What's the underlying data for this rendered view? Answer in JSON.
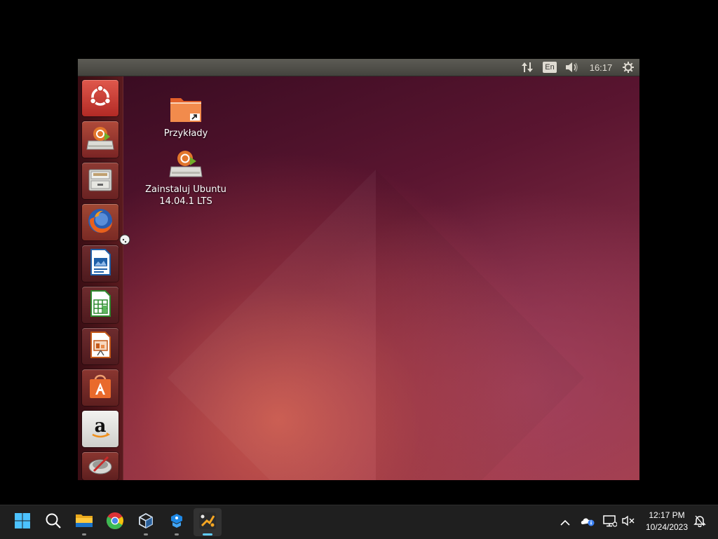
{
  "vm": {
    "panel": {
      "language_indicator": "En",
      "clock": "16:17",
      "icons": [
        "network-transfer-icon",
        "volume-icon",
        "system-gear-icon"
      ]
    },
    "launcher": {
      "items": [
        {
          "name": "dash-home",
          "icon": "ubuntu-logo-icon"
        },
        {
          "name": "install-ubuntu",
          "icon": "installer-icon"
        },
        {
          "name": "files",
          "icon": "file-cabinet-icon"
        },
        {
          "name": "firefox",
          "icon": "firefox-icon"
        },
        {
          "name": "libreoffice-writer",
          "icon": "writer-icon"
        },
        {
          "name": "libreoffice-calc",
          "icon": "calc-icon"
        },
        {
          "name": "libreoffice-impress",
          "icon": "impress-icon"
        },
        {
          "name": "ubuntu-software-center",
          "icon": "shopping-bag-icon"
        },
        {
          "name": "amazon",
          "icon": "amazon-icon"
        },
        {
          "name": "system-settings",
          "icon": "settings-icon"
        }
      ]
    },
    "desktop": {
      "icons": [
        {
          "label": "Przykłady",
          "icon": "folder-link-icon"
        },
        {
          "label": "Zainstaluj Ubuntu 14.04.1 LTS",
          "icon": "installer-icon"
        }
      ]
    },
    "colors": {
      "accent": "#dd4814",
      "panel": "#4a4944",
      "launcher": "#4c1419"
    }
  },
  "taskbar": {
    "apps": [
      {
        "name": "start",
        "icon": "windows-start-icon"
      },
      {
        "name": "search",
        "icon": "search-icon"
      },
      {
        "name": "file-explorer",
        "icon": "folder-icon"
      },
      {
        "name": "chrome",
        "icon": "chrome-icon"
      },
      {
        "name": "virtualbox",
        "icon": "virtualbox-icon"
      },
      {
        "name": "app-blue",
        "icon": "blue-cube-icon"
      },
      {
        "name": "active-app",
        "icon": "ubuntu-vm-icon"
      }
    ],
    "tray": {
      "time": "12:17 PM",
      "date": "10/24/2023"
    }
  }
}
